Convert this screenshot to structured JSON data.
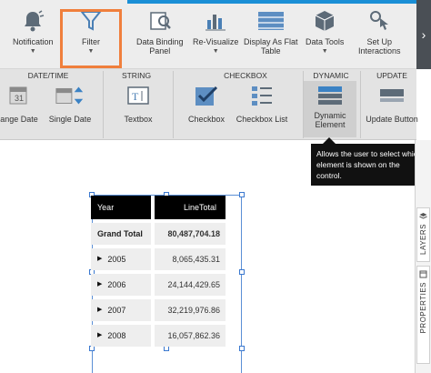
{
  "ribbon": {
    "buttons": [
      {
        "label": "Notification",
        "icon": "bell-icon"
      },
      {
        "label": "Filter",
        "icon": "funnel-icon"
      },
      {
        "label_line1": "Data Binding",
        "label_line2": "Panel",
        "icon": "data-binding-icon"
      },
      {
        "label": "Re-Visualize",
        "icon": "chart-icon"
      },
      {
        "label_line1": "Display As Flat",
        "label_line2": "Table",
        "icon": "table-icon"
      },
      {
        "label": "Data Tools",
        "icon": "data-tools-icon"
      },
      {
        "label_line1": "Set Up",
        "label_line2": "Interactions",
        "icon": "interactions-icon"
      }
    ],
    "scroll_glyph": "›"
  },
  "subribbon": {
    "groups": [
      "DATE/TIME",
      "STRING",
      "CHECKBOX",
      "DYNAMIC",
      "UPDATE"
    ],
    "items": [
      {
        "label": "ange Date",
        "icon": "calendar-range-icon"
      },
      {
        "label": "Single Date",
        "icon": "calendar-spinner-icon"
      },
      {
        "label": "Textbox",
        "icon": "textbox-icon"
      },
      {
        "label": "Checkbox",
        "icon": "checkbox-icon"
      },
      {
        "label": "Checkbox List",
        "icon": "checkbox-list-icon"
      },
      {
        "label_line1": "Dynamic",
        "label_line2": "Element",
        "icon": "dynamic-element-icon"
      },
      {
        "label": "Update Button",
        "icon": "update-button-icon"
      }
    ]
  },
  "tooltip": {
    "line1": "Allows the user to select which",
    "line2": "element is shown on the",
    "line3": "control."
  },
  "side_tabs": [
    "LAYERS",
    "PROPERTIES"
  ],
  "table": {
    "headers": [
      "Year",
      "LineTotal"
    ],
    "grand_total": {
      "label": "Grand Total",
      "value": "80,487,704.18"
    },
    "rows": [
      {
        "year": "2005",
        "value": "8,065,435.31"
      },
      {
        "year": "2006",
        "value": "24,144,429.65"
      },
      {
        "year": "2007",
        "value": "32,219,976.86"
      },
      {
        "year": "2008",
        "value": "16,057,862.36"
      }
    ]
  },
  "colors": {
    "accent": "#1a8fd6",
    "highlight": "#f07f3c",
    "dark_scroll": "#4a4f55"
  }
}
